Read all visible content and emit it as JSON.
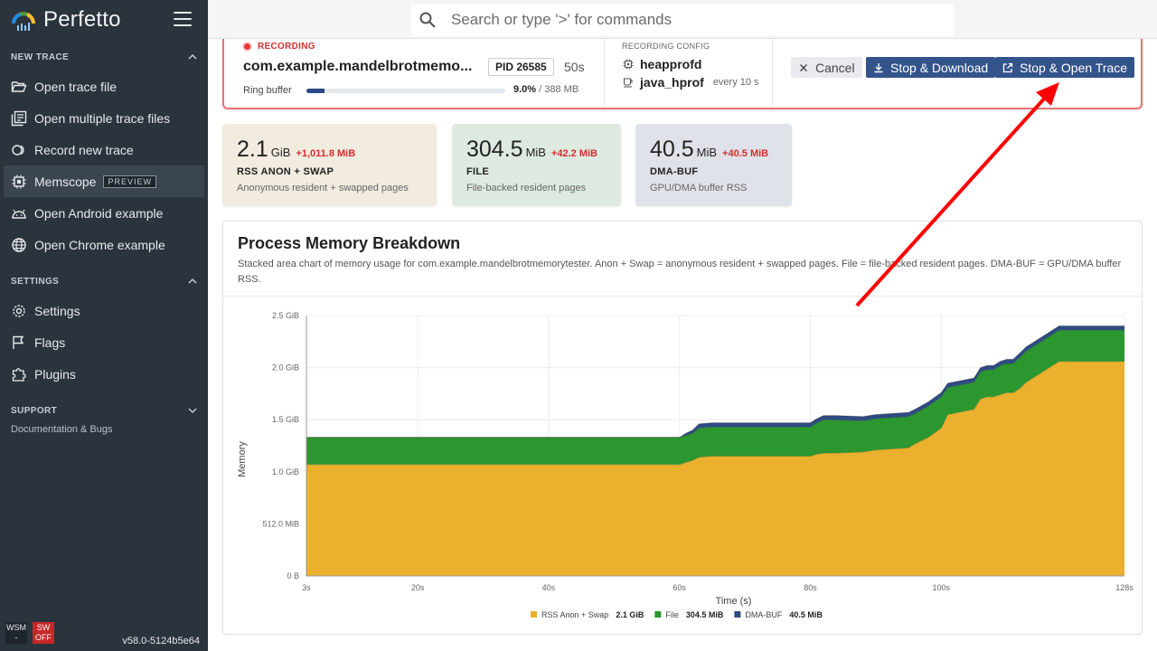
{
  "app": {
    "name": "Perfetto",
    "version": "v58.0-5124b5e64",
    "wsm_label": "WSM",
    "wsm_value": "-",
    "sw_label": "SW",
    "sw_value": "OFF"
  },
  "search": {
    "placeholder": "Search or type '>' for commands"
  },
  "sidebar": {
    "new_trace": {
      "title": "NEW TRACE",
      "items": [
        {
          "label": "Open trace file",
          "icon": "folder-open-icon"
        },
        {
          "label": "Open multiple trace files",
          "icon": "library-icon"
        },
        {
          "label": "Record new trace",
          "icon": "record-icon"
        },
        {
          "label": "Memscope",
          "icon": "chip-icon",
          "badge": "PREVIEW",
          "active": true
        },
        {
          "label": "Open Android example",
          "icon": "android-icon"
        },
        {
          "label": "Open Chrome example",
          "icon": "globe-icon"
        }
      ]
    },
    "settings": {
      "title": "SETTINGS",
      "items": [
        {
          "label": "Settings",
          "icon": "gear-icon"
        },
        {
          "label": "Flags",
          "icon": "flag-icon"
        },
        {
          "label": "Plugins",
          "icon": "puzzle-icon"
        }
      ]
    },
    "support": {
      "title": "SUPPORT",
      "items": [
        {
          "label": "Documentation & Bugs"
        }
      ]
    }
  },
  "recording": {
    "status": "RECORDING",
    "process": "com.example.mandelbrotmemo...",
    "pid": "PID 26585",
    "elapsed": "50s",
    "ring_label": "Ring buffer",
    "ring_fraction": 0.09,
    "ring_pct": "9.0%",
    "ring_total": "/ 388 MB",
    "config_title": "RECORDING CONFIG",
    "config": [
      {
        "name": "heapprofd",
        "icon": "chip-icon",
        "note": ""
      },
      {
        "name": "java_hprof",
        "icon": "coffee-icon",
        "note": "every 10 s"
      }
    ],
    "buttons": {
      "cancel": "Cancel",
      "stop_download": "Stop & Download",
      "stop_open": "Stop & Open Trace"
    }
  },
  "stats": [
    {
      "value": "2.1",
      "unit": "GiB",
      "delta": "+1,011.8 MiB",
      "name": "RSS ANON + SWAP",
      "desc": "Anonymous resident + swapped pages",
      "bg": "#f1ebe0"
    },
    {
      "value": "304.5",
      "unit": "MiB",
      "delta": "+42.2 MiB",
      "name": "FILE",
      "desc": "File-backed resident pages",
      "bg": "#deeadf"
    },
    {
      "value": "40.5",
      "unit": "MiB",
      "delta": "+40.5 MiB",
      "name": "DMA-BUF",
      "desc": "GPU/DMA buffer RSS",
      "bg": "#dfe2e8"
    }
  ],
  "chart_data": {
    "type": "area",
    "stacked": true,
    "title": "Process Memory Breakdown",
    "description": "Stacked area chart of memory usage for com.example.mandelbrotmemorytester. Anon + Swap = anonymous resident + swapped pages. File = file-backed resident pages. DMA-BUF = GPU/DMA buffer RSS.",
    "xlabel": "Time (s)",
    "ylabel": "Memory",
    "xlim": [
      3,
      128
    ],
    "ylim_gib": [
      0,
      2.5
    ],
    "x_ticks": [
      {
        "v": 3,
        "label": "3s"
      },
      {
        "v": 20,
        "label": "20s"
      },
      {
        "v": 40,
        "label": "40s"
      },
      {
        "v": 60,
        "label": "60s"
      },
      {
        "v": 80,
        "label": "80s"
      },
      {
        "v": 100,
        "label": "100s"
      },
      {
        "v": 128,
        "label": "128s"
      }
    ],
    "y_ticks": [
      {
        "v": 0,
        "label": "0 B"
      },
      {
        "v": 0.5,
        "label": "512.0 MiB"
      },
      {
        "v": 1.0,
        "label": "1.0 GiB"
      },
      {
        "v": 1.5,
        "label": "1.5 GiB"
      },
      {
        "v": 2.0,
        "label": "2.0 GiB"
      },
      {
        "v": 2.5,
        "label": "2.5 GiB"
      }
    ],
    "x": [
      3,
      60,
      61,
      62,
      63,
      65,
      70,
      80,
      81,
      82,
      84,
      88,
      90,
      95,
      96,
      98,
      100,
      101,
      105,
      106,
      107,
      108,
      109,
      110,
      111,
      112,
      113,
      115,
      116,
      118,
      128
    ],
    "series": [
      {
        "name": "RSS Anon + Swap",
        "color": "#ebb02e",
        "legend_value": "2.1 GiB",
        "values": [
          1.07,
          1.07,
          1.09,
          1.11,
          1.14,
          1.15,
          1.15,
          1.15,
          1.17,
          1.18,
          1.18,
          1.19,
          1.21,
          1.23,
          1.27,
          1.33,
          1.42,
          1.55,
          1.6,
          1.7,
          1.72,
          1.72,
          1.74,
          1.76,
          1.76,
          1.8,
          1.86,
          1.94,
          1.98,
          2.06,
          2.06
        ]
      },
      {
        "name": "File",
        "color": "#2c962f",
        "legend_value": "304.5 MiB",
        "values": [
          0.26,
          0.26,
          0.26,
          0.26,
          0.28,
          0.28,
          0.28,
          0.28,
          0.3,
          0.32,
          0.32,
          0.3,
          0.3,
          0.3,
          0.29,
          0.3,
          0.3,
          0.26,
          0.26,
          0.26,
          0.26,
          0.26,
          0.28,
          0.28,
          0.28,
          0.3,
          0.3,
          0.3,
          0.3,
          0.3,
          0.3
        ]
      },
      {
        "name": "DMA-BUF",
        "color": "#2e4b82",
        "legend_value": "40.5 MiB",
        "values": [
          0,
          0,
          0.02,
          0.03,
          0.04,
          0.04,
          0.04,
          0.04,
          0.04,
          0.04,
          0.04,
          0.04,
          0.04,
          0.04,
          0.04,
          0.04,
          0.04,
          0.04,
          0.04,
          0.04,
          0.04,
          0.04,
          0.04,
          0.04,
          0.04,
          0.04,
          0.04,
          0.04,
          0.04,
          0.04,
          0.04
        ]
      }
    ]
  }
}
